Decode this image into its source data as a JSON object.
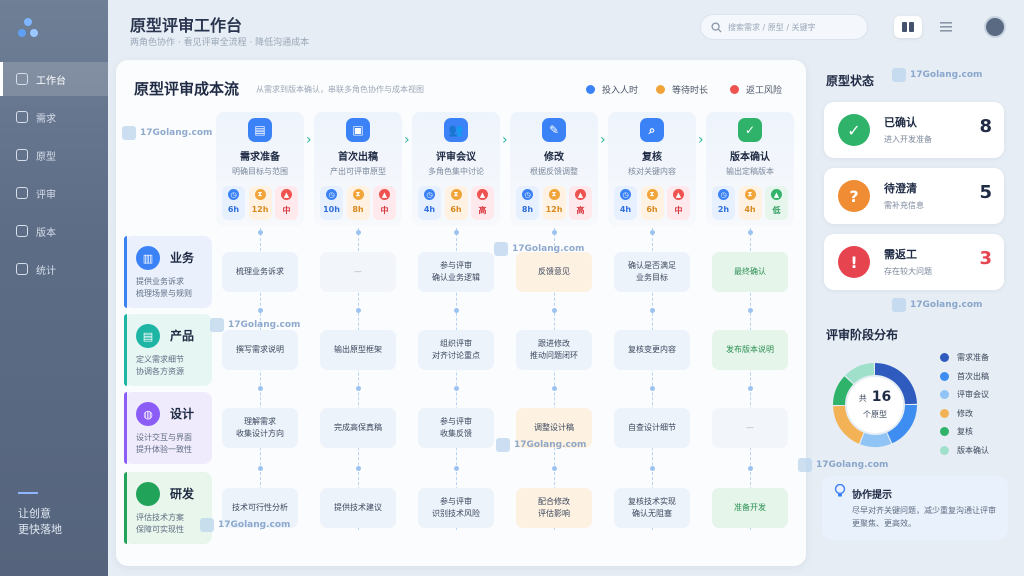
{
  "app": {
    "title": "原型评审工作台",
    "subtitle": "两角色协作 · 看见评审全流程 · 降低沟通成本"
  },
  "sidebar": {
    "items": [
      {
        "label": "工作台",
        "icon": "home-icon",
        "active": true
      },
      {
        "label": "需求",
        "icon": "document-icon",
        "active": false
      },
      {
        "label": "原型",
        "icon": "prototype-icon",
        "active": false
      },
      {
        "label": "评审",
        "icon": "review-icon",
        "active": false
      },
      {
        "label": "版本",
        "icon": "version-icon",
        "active": false
      },
      {
        "label": "统计",
        "icon": "chart-icon",
        "active": false
      }
    ],
    "motto_line1": "让创意",
    "motto_line2": "更快落地"
  },
  "header": {
    "search_placeholder": "搜索需求 / 原型 / 关键字"
  },
  "flow": {
    "title": "原型评审成本流",
    "subtitle": "从需求到版本确认，串联多角色协作与成本视图",
    "legend": [
      {
        "label": "投入人时",
        "color": "#3b82f6"
      },
      {
        "label": "等待时长",
        "color": "#f0a43a"
      },
      {
        "label": "返工风险",
        "color": "#ef5350"
      }
    ],
    "stages": [
      {
        "name": "需求准备",
        "desc": "明确目标与范围",
        "icon": "document-icon",
        "hours": "6h",
        "wait": "12h",
        "risk": "中",
        "risk_level": "red"
      },
      {
        "name": "首次出稿",
        "desc": "产出可评审原型",
        "icon": "image-icon",
        "hours": "10h",
        "wait": "8h",
        "risk": "中",
        "risk_level": "red"
      },
      {
        "name": "评审会议",
        "desc": "多角色集中讨论",
        "icon": "people-icon",
        "hours": "4h",
        "wait": "6h",
        "risk": "高",
        "risk_level": "red"
      },
      {
        "name": "修改",
        "desc": "根据反馈调整",
        "icon": "edit-icon",
        "hours": "8h",
        "wait": "12h",
        "risk": "高",
        "risk_level": "red"
      },
      {
        "name": "复核",
        "desc": "核对关键内容",
        "icon": "search-icon",
        "hours": "4h",
        "wait": "6h",
        "risk": "中",
        "risk_level": "red"
      },
      {
        "name": "版本确认",
        "desc": "输出定稿版本",
        "icon": "check-icon",
        "hours": "2h",
        "wait": "4h",
        "risk": "低",
        "risk_level": "green"
      }
    ],
    "roles": [
      {
        "name": "业务",
        "desc1": "提供业务诉求",
        "desc2": "梳理场景与规则",
        "icon": "bar-chart-icon",
        "color": "#3b82f6",
        "cells": [
          {
            "text": "梳理业务诉求",
            "style": "blue"
          },
          {
            "text": "—",
            "style": "empty"
          },
          {
            "text": "参与评审\n确认业务逻辑",
            "style": "blue"
          },
          {
            "text": "反馈意见",
            "style": "orange"
          },
          {
            "text": "确认是否满足\n业务目标",
            "style": "blue"
          },
          {
            "text": "最终确认",
            "style": "green"
          }
        ]
      },
      {
        "name": "产品",
        "desc1": "定义需求细节",
        "desc2": "协调各方资源",
        "icon": "file-icon",
        "color": "#1fb5a5",
        "cells": [
          {
            "text": "撰写需求说明",
            "style": "blue"
          },
          {
            "text": "输出原型框架",
            "style": "blue"
          },
          {
            "text": "组织评审\n对齐讨论重点",
            "style": "blue"
          },
          {
            "text": "跟进修改\n推动问题闭环",
            "style": "blue"
          },
          {
            "text": "复核变更内容",
            "style": "blue"
          },
          {
            "text": "发布版本说明",
            "style": "green"
          }
        ]
      },
      {
        "name": "设计",
        "desc1": "设计交互与界面",
        "desc2": "提升体验一致性",
        "icon": "palette-icon",
        "color": "#8b5cf6",
        "cells": [
          {
            "text": "理解需求\n收集设计方向",
            "style": "blue"
          },
          {
            "text": "完成高保真稿",
            "style": "blue"
          },
          {
            "text": "参与评审\n收集反馈",
            "style": "blue"
          },
          {
            "text": "调整设计稿",
            "style": "orange"
          },
          {
            "text": "自查设计细节",
            "style": "blue"
          },
          {
            "text": "—",
            "style": "empty"
          }
        ]
      },
      {
        "name": "研发",
        "desc1": "评估技术方案",
        "desc2": "保障可实现性",
        "icon": "code-icon",
        "color": "#22a35a",
        "cells": [
          {
            "text": "技术可行性分析",
            "style": "blue"
          },
          {
            "text": "提供技术建议",
            "style": "blue"
          },
          {
            "text": "参与评审\n识别技术风险",
            "style": "blue"
          },
          {
            "text": "配合修改\n评估影响",
            "style": "orange"
          },
          {
            "text": "复核技术实现\n确认无阻塞",
            "style": "blue"
          },
          {
            "text": "准备开发",
            "style": "green"
          }
        ]
      }
    ]
  },
  "status": {
    "title": "原型状态",
    "cards": [
      {
        "label": "已确认",
        "desc": "进入开发准备",
        "count": "8",
        "icon": "check-icon",
        "color": "#2fb36a",
        "count_color": "#1f2a44"
      },
      {
        "label": "待澄清",
        "desc": "需补充信息",
        "count": "5",
        "icon": "question-icon",
        "color": "#f08c34",
        "count_color": "#1f2a44"
      },
      {
        "label": "需返工",
        "desc": "存在较大问题",
        "count": "3",
        "icon": "alert-icon",
        "color": "#e64550",
        "count_color": "#e64550"
      }
    ]
  },
  "distribution": {
    "title": "评审阶段分布",
    "center_prefix": "共",
    "center_total": "16",
    "center_unit": "个原型"
  },
  "chart_data": {
    "type": "pie",
    "categories": [
      "需求准备",
      "首次出稿",
      "评审会议",
      "修改",
      "复核",
      "版本确认"
    ],
    "values": [
      4,
      3,
      2,
      3,
      2,
      2
    ],
    "colors": [
      "#2f5bbf",
      "#3d8ef0",
      "#8fc4f4",
      "#f3b256",
      "#2fb36a",
      "#9fe0cb"
    ],
    "title": "评审阶段分布",
    "total": 16
  },
  "tip": {
    "title": "协作提示",
    "text": "尽早对齐关键问题，减少重复沟通让评审更聚焦、更高效。"
  },
  "watermark": "17Golang.com"
}
